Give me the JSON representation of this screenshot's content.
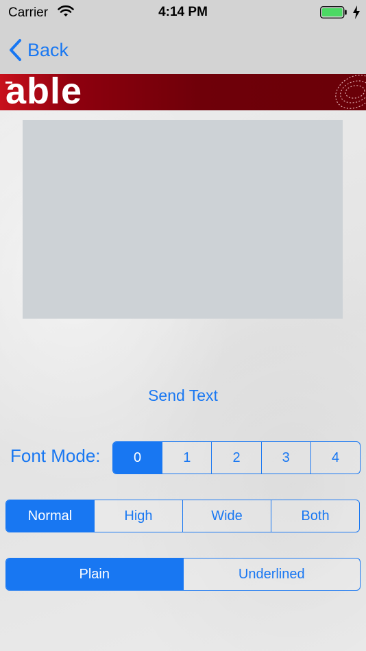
{
  "status_bar": {
    "carrier": "Carrier",
    "time": "4:14 PM"
  },
  "nav": {
    "back_label": "Back"
  },
  "banner": {
    "logo": "able"
  },
  "main": {
    "send_text_label": "Send Text",
    "font_mode_label": "Font Mode:",
    "font_modes": [
      "0",
      "1",
      "2",
      "3",
      "4"
    ],
    "font_mode_selected": "0",
    "sizes": [
      "Normal",
      "High",
      "Wide",
      "Both"
    ],
    "size_selected": "Normal",
    "styles": [
      "Plain",
      "Underlined"
    ],
    "style_selected": "Plain"
  },
  "colors": {
    "accent": "#1877f2",
    "banner_red": "#6f0009",
    "battery_green": "#4cd964"
  }
}
